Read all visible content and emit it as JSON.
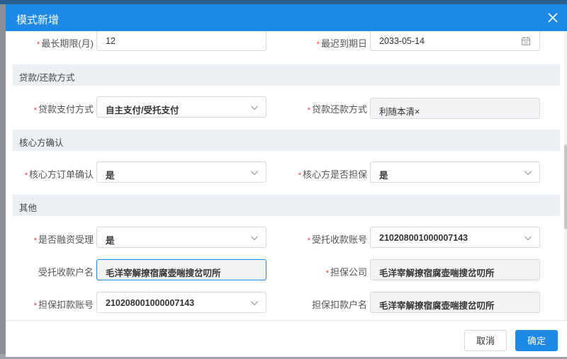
{
  "dialog": {
    "title": "模式新增"
  },
  "row_max_period": {
    "label": "最长期限(月)",
    "value": "12",
    "label2": "最迟到期日",
    "value2": "2033-05-14"
  },
  "sections": {
    "loan_repay": "贷款/还款方式",
    "core_confirm": "核心方确认",
    "other": "其他"
  },
  "row_payment": {
    "label": "贷款支付方式",
    "value": "自主支付/受托支付",
    "label2": "贷款还款方式",
    "value2": "利随本清×"
  },
  "row_core": {
    "label": "核心方订单确认",
    "value": "是",
    "label2": "核心方是否担保",
    "value2": "是"
  },
  "row_financing": {
    "label": "是否融资受理",
    "value": "是",
    "label2": "受托收款账号",
    "value2": "210208001000007143"
  },
  "row_trustee_name": {
    "label": "受托收款户名",
    "value": "毛洋宰解撩宿腐壶喘搜岔叨所",
    "label2": "担保公司",
    "value2": "毛洋宰解撩宿腐壶喘搜岔叨所"
  },
  "row_guarantee": {
    "label": "担保扣款账号",
    "value": "210208001000007143",
    "label2": "担保扣款户名",
    "value2": "毛洋宰解撩宿腐壶喘搜岔叨所"
  },
  "footer": {
    "cancel": "取消",
    "ok": "确定"
  },
  "colors": {
    "primary": "#1e88e5",
    "required": "#e53935"
  }
}
